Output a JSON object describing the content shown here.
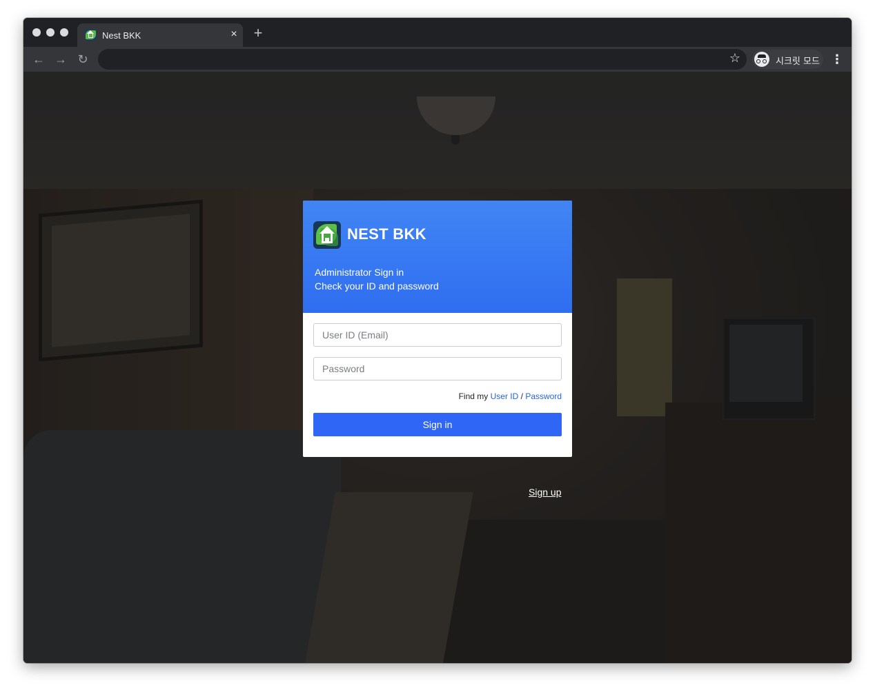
{
  "browser": {
    "tab_title": "Nest BKK",
    "tab_close_icon": "×",
    "new_tab_icon": "+",
    "back_icon": "←",
    "forward_icon": "→",
    "reload_icon": "↻",
    "url": "",
    "bookmark_icon": "☆",
    "incognito_label": "시크릿 모드",
    "menu_icon": "⋮"
  },
  "login": {
    "brand": "NEST BKK",
    "subtitle_line1": "Administrator Sign in",
    "subtitle_line2": "Check your ID and password",
    "user_placeholder": "User ID (Email)",
    "password_placeholder": "Password",
    "find_prefix": "Find my",
    "find_user_link": "User ID",
    "find_separator": "/",
    "find_password_link": "Password",
    "signin_label": "Sign in",
    "signup_label": "Sign up"
  },
  "colors": {
    "header_blue": "#4185f4",
    "button_blue": "#2f66f5",
    "link_blue": "#2563eb"
  }
}
